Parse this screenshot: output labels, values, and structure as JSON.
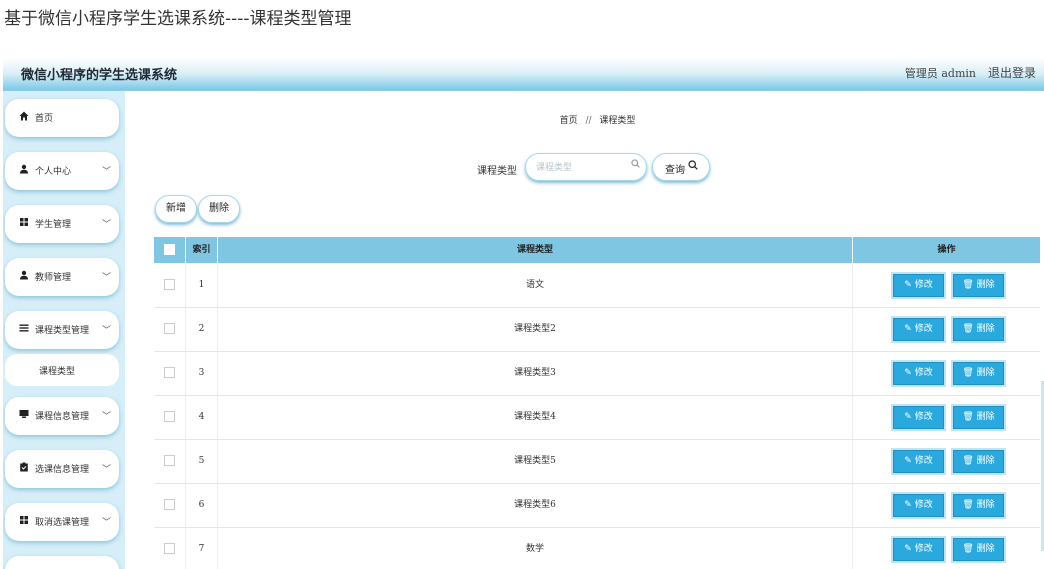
{
  "page_caption": "基于微信小程序学生选课系统----课程类型管理",
  "header": {
    "brand": "微信小程序的学生选课系统",
    "user": "管理员 admin",
    "logout": "退出登录"
  },
  "sidebar": {
    "items": [
      {
        "label": "首页",
        "icon": "home-icon",
        "expandable": false
      },
      {
        "label": "个人中心",
        "icon": "person-icon",
        "expandable": true
      },
      {
        "label": "学生管理",
        "icon": "grid-icon",
        "expandable": true
      },
      {
        "label": "教师管理",
        "icon": "person-icon",
        "expandable": true
      },
      {
        "label": "课程类型管理",
        "icon": "list-icon",
        "expandable": true,
        "expanded": true
      },
      {
        "label": "课程信息管理",
        "icon": "monitor-icon",
        "expandable": true
      },
      {
        "label": "选课信息管理",
        "icon": "clipboard-icon",
        "expandable": true
      },
      {
        "label": "取消选课管理",
        "icon": "grid-icon",
        "expandable": true
      }
    ],
    "subitem": "课程类型"
  },
  "breadcrumb": {
    "home": "首页",
    "separator": "//",
    "current": "课程类型"
  },
  "search": {
    "label": "课程类型",
    "placeholder": "课程类型",
    "value": "",
    "button": "查询"
  },
  "actions": {
    "add": "新增",
    "delete": "删除"
  },
  "table": {
    "headers": {
      "index": "索引",
      "type": "课程类型",
      "ops": "操作"
    },
    "edit_label": "修改",
    "delete_label": "删除",
    "rows": [
      {
        "index": "1",
        "type": "语文"
      },
      {
        "index": "2",
        "type": "课程类型2"
      },
      {
        "index": "3",
        "type": "课程类型3"
      },
      {
        "index": "4",
        "type": "课程类型4"
      },
      {
        "index": "5",
        "type": "课程类型5"
      },
      {
        "index": "6",
        "type": "课程类型6"
      },
      {
        "index": "7",
        "type": "数学"
      }
    ]
  },
  "colors": {
    "accent": "#7fc6e2",
    "button": "#29a9dd",
    "sidebar_bg": "#d6eef7"
  }
}
